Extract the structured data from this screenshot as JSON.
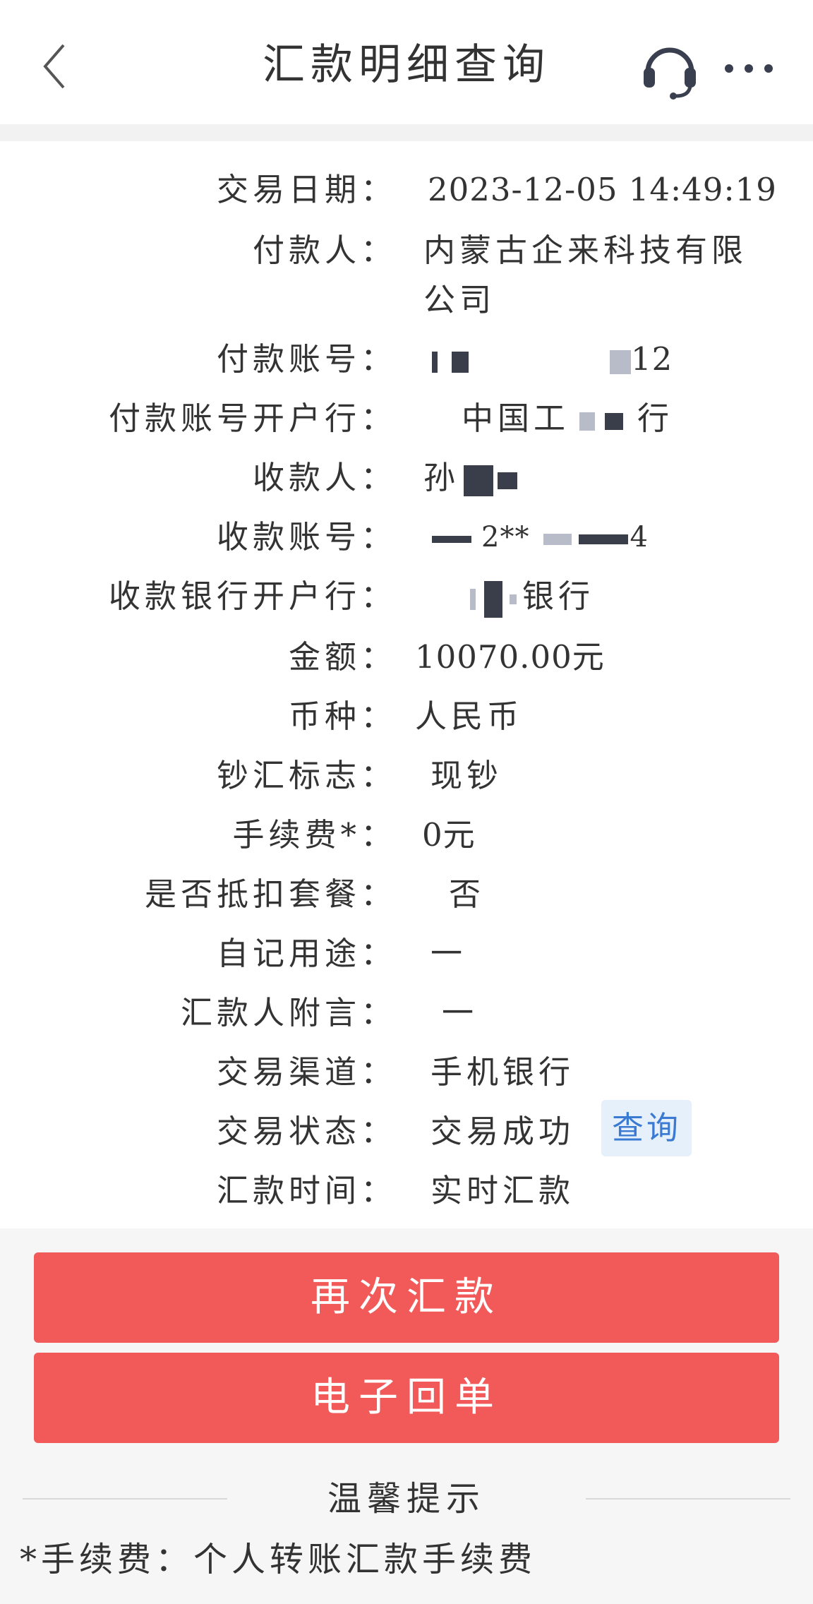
{
  "header": {
    "title": "汇款明细查询"
  },
  "details": {
    "trade_date": {
      "label": "交易日期：",
      "value": "2023-12-05 14:49:19"
    },
    "payer": {
      "label": "付款人：",
      "value_line1": "内蒙古企来科技有限",
      "value_line2": "公司"
    },
    "payer_account": {
      "label": "付款账号：",
      "value_tail": "12"
    },
    "payer_bank": {
      "label": "付款账号开户行：",
      "value_head": "中国工",
      "value_tail": "行"
    },
    "payee": {
      "label": "收款人：",
      "value_head": "孙"
    },
    "payee_account": {
      "label": "收款账号：",
      "value_mid": "2**",
      "value_tail": "4"
    },
    "payee_bank": {
      "label": "收款银行开户行：",
      "value_tail": "银行"
    },
    "amount": {
      "label": "金额：",
      "value": "10070.00元"
    },
    "currency": {
      "label": "币种：",
      "value": "人民币"
    },
    "cash_flag": {
      "label": "钞汇标志：",
      "value": "现钞"
    },
    "fee": {
      "label": "手续费*：",
      "value": "0元"
    },
    "deduct_package": {
      "label": "是否抵扣套餐：",
      "value": "否"
    },
    "purpose": {
      "label": "自记用途：",
      "value": "一"
    },
    "remitter_note": {
      "label": "汇款人附言：",
      "value": "一"
    },
    "channel": {
      "label": "交易渠道：",
      "value": "手机银行"
    },
    "status": {
      "label": "交易状态：",
      "value": "交易成功",
      "query_label": "查询"
    },
    "remit_time": {
      "label": "汇款时间：",
      "value": "实时汇款"
    }
  },
  "actions": {
    "remit_again": "再次汇款",
    "e_receipt": "电子回单"
  },
  "tips": {
    "title": "温馨提示",
    "fee_note": "*手续费：个人转账汇款手续费"
  },
  "colors": {
    "primary_button": "#f25a5a",
    "link": "#3b7ad3"
  }
}
